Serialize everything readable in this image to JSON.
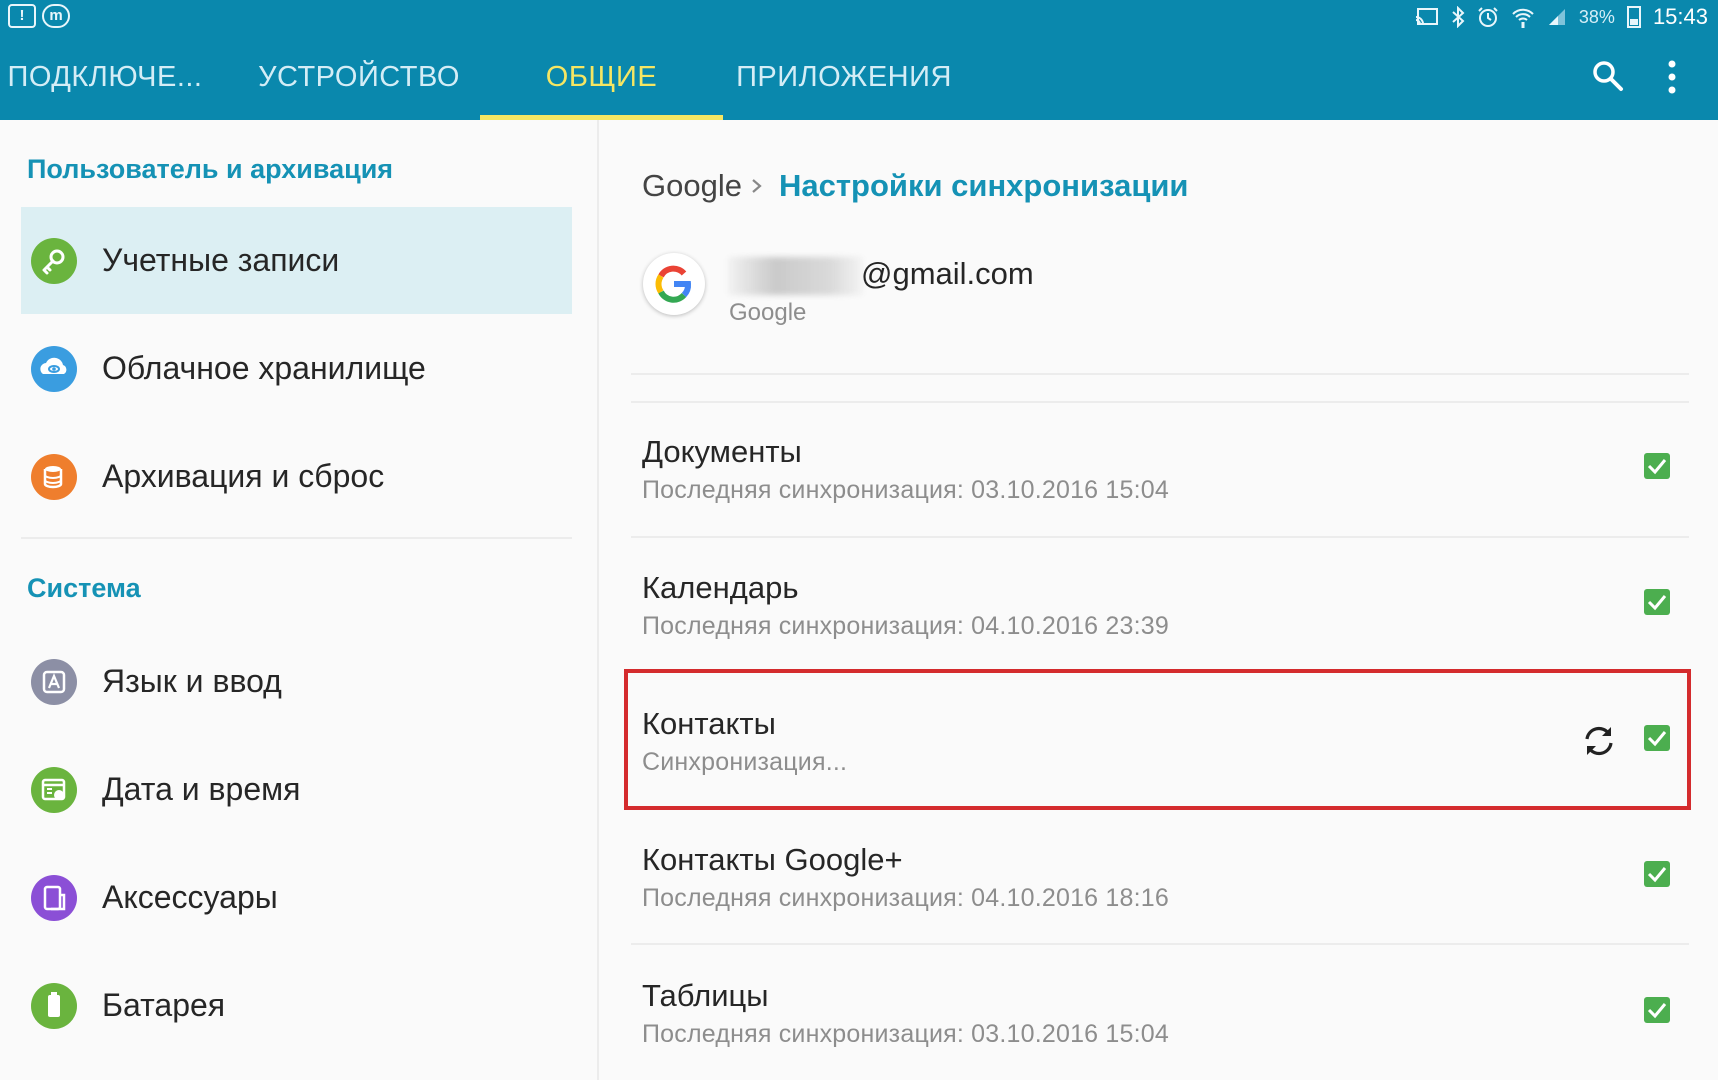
{
  "status_bar": {
    "battery": "38%",
    "time": "15:43",
    "icons": [
      "alert-icon",
      "messenger-icon",
      "cast-icon",
      "bluetooth-icon",
      "alarm-icon",
      "wifi-icon",
      "signal-icon",
      "battery-icon"
    ]
  },
  "tabs": [
    {
      "label": "ПОДКЛЮЧЕ..."
    },
    {
      "label": "УСТРОЙСТВО"
    },
    {
      "label": "ОБЩИЕ",
      "active": true
    },
    {
      "label": "ПРИЛОЖЕНИЯ"
    }
  ],
  "toolbar": {
    "icons": [
      "search-icon",
      "more-vert-icon"
    ]
  },
  "sidebar": {
    "sections": [
      {
        "title": "Пользователь и архивация",
        "items": [
          {
            "label": "Учетные записи",
            "icon": "key-icon",
            "color": "#6ab43e",
            "selected": true
          },
          {
            "label": "Облачное хранилище",
            "icon": "cloud-icon",
            "color": "#3a9de0"
          },
          {
            "label": "Архивация и сброс",
            "icon": "backup-icon",
            "color": "#ef7e2d"
          }
        ]
      },
      {
        "title": "Система",
        "items": [
          {
            "label": "Язык и ввод",
            "icon": "language-icon",
            "color": "#8c8fa5"
          },
          {
            "label": "Дата и время",
            "icon": "calendar-icon",
            "color": "#6ab43e"
          },
          {
            "label": "Аксессуары",
            "icon": "accessory-icon",
            "color": "#8b4fd6"
          },
          {
            "label": "Батарея",
            "icon": "battery-icon",
            "color": "#6ab43e"
          }
        ]
      }
    ]
  },
  "breadcrumb": {
    "root": "Google",
    "current": "Настройки синхронизации"
  },
  "account": {
    "email": "@gmail.com",
    "type": "Google"
  },
  "sync_items": [
    {
      "title": "Документы",
      "subtitle": "Последняя синхронизация: 03.10.2016  15:04",
      "checked": true
    },
    {
      "title": "Календарь",
      "subtitle": "Последняя синхронизация: 04.10.2016  23:39",
      "checked": true
    },
    {
      "title": "Контакты",
      "subtitle": "Синхронизация...",
      "checked": true,
      "syncing": true,
      "highlighted": true
    },
    {
      "title": "Контакты Google+",
      "subtitle": "Последняя синхронизация: 04.10.2016  18:16",
      "checked": true
    },
    {
      "title": "Таблицы",
      "subtitle": "Последняя синхронизация: 03.10.2016  15:04",
      "checked": true
    }
  ],
  "colors": {
    "accent": "#0a88ad",
    "active_tab": "#f5e663",
    "section_title": "#1592b5",
    "checkbox": "#4cae4f",
    "highlight_border": "#d42b2d"
  }
}
